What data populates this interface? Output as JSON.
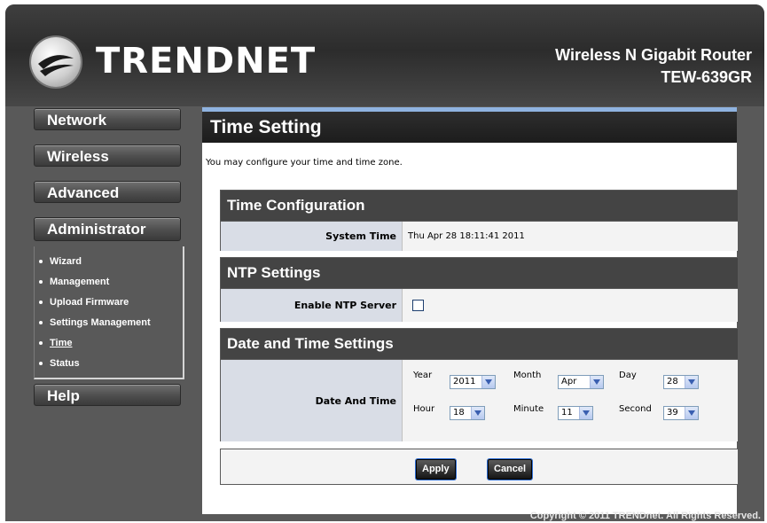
{
  "header": {
    "brand": "TRENDNET",
    "product_name": "Wireless N Gigabit Router",
    "model": "TEW-639GR"
  },
  "sidebar": {
    "menus": [
      "Network",
      "Wireless",
      "Advanced",
      "Administrator",
      "Help"
    ],
    "admin_items": [
      {
        "label": "Wizard",
        "active": false
      },
      {
        "label": "Management",
        "active": false
      },
      {
        "label": "Upload Firmware",
        "active": false
      },
      {
        "label": "Settings Management",
        "active": false
      },
      {
        "label": "Time",
        "active": true
      },
      {
        "label": "Status",
        "active": false
      }
    ]
  },
  "page": {
    "title": "Time Setting",
    "intro": "You may configure your time and time zone."
  },
  "time_config": {
    "heading": "Time Configuration",
    "system_time_label": "System Time",
    "system_time_value": "Thu Apr 28 18:11:41 2011"
  },
  "ntp": {
    "heading": "NTP Settings",
    "enable_label": "Enable NTP Server",
    "enabled": false
  },
  "date_time": {
    "heading": "Date and Time Settings",
    "row_label": "Date And Time",
    "year_label": "Year",
    "year_value": "2011",
    "month_label": "Month",
    "month_value": "Apr",
    "day_label": "Day",
    "day_value": "28",
    "hour_label": "Hour",
    "hour_value": "18",
    "minute_label": "Minute",
    "minute_value": "11",
    "second_label": "Second",
    "second_value": "39"
  },
  "buttons": {
    "apply": "Apply",
    "cancel": "Cancel"
  },
  "footer": {
    "copyright": "Copyright © 2011 TRENDnet. All Rights Reserved."
  }
}
